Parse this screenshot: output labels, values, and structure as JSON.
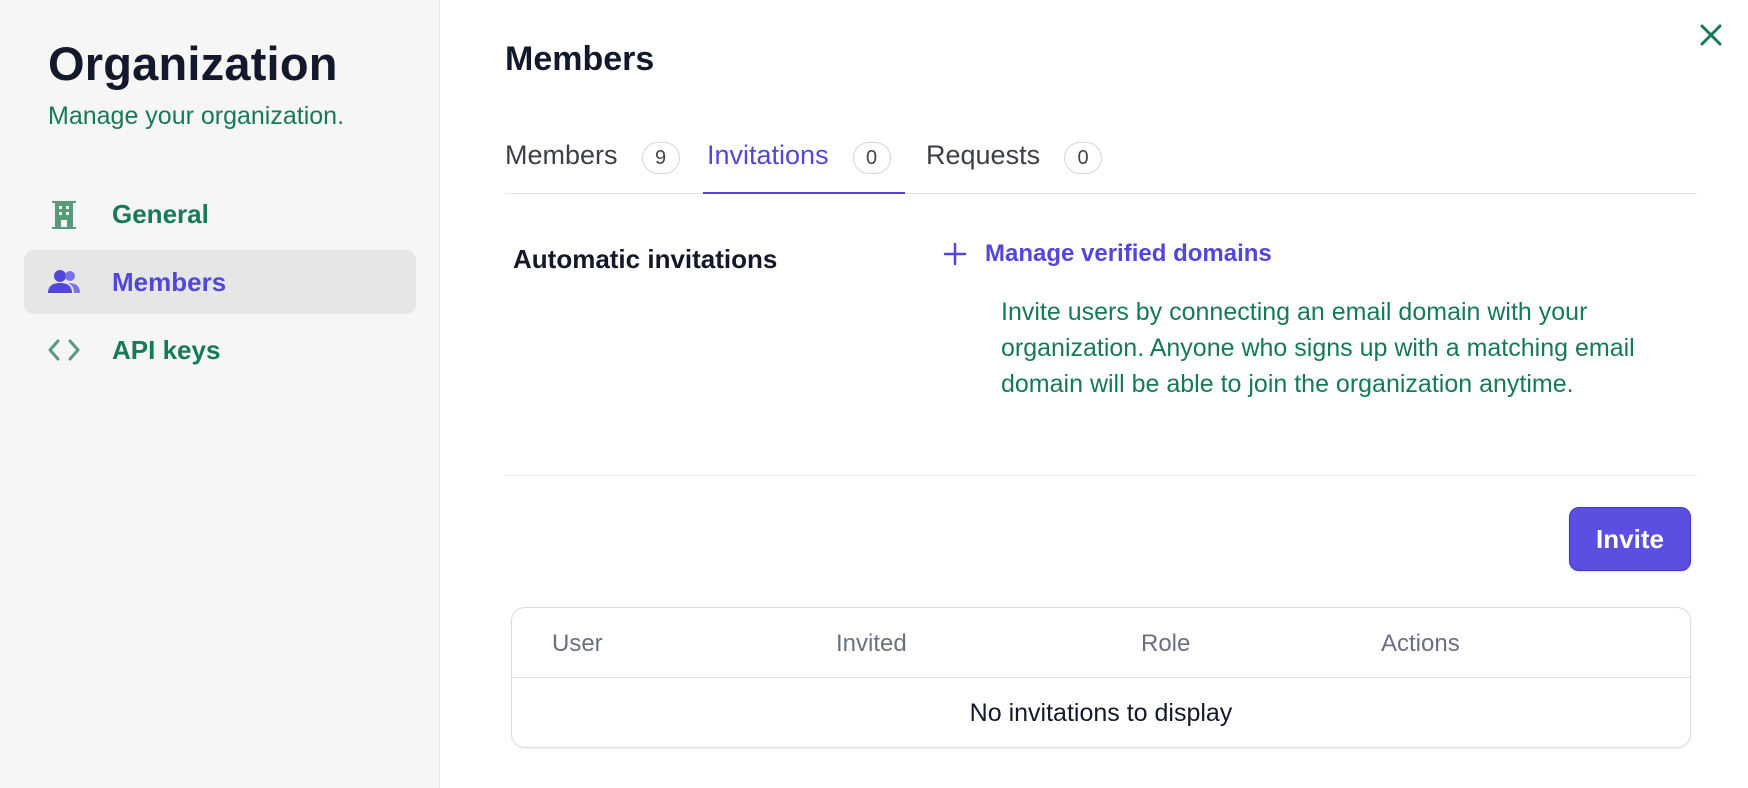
{
  "sidebar": {
    "title": "Organization",
    "subtitle": "Manage your organization.",
    "items": [
      {
        "label": "General",
        "icon": "building-icon",
        "active": false
      },
      {
        "label": "Members",
        "icon": "users-icon",
        "active": true
      },
      {
        "label": "API keys",
        "icon": "code-icon",
        "active": false
      }
    ]
  },
  "main": {
    "title": "Members",
    "close_icon": "close-icon",
    "tabs": [
      {
        "label": "Members",
        "count": "9",
        "active": false
      },
      {
        "label": "Invitations",
        "count": "0",
        "active": true
      },
      {
        "label": "Requests",
        "count": "0",
        "active": false
      }
    ],
    "automatic": {
      "label": "Automatic invitations",
      "link_icon": "plus-icon",
      "link_label": "Manage verified domains",
      "description": "Invite users by connecting an email domain with your organization. Anyone who signs up with a matching email domain will be able to join the organization anytime."
    },
    "invite_label": "Invite",
    "table": {
      "columns": [
        "User",
        "Invited",
        "Role",
        "Actions"
      ],
      "empty_text": "No invitations to display"
    }
  },
  "colors": {
    "accent": "#5247d8",
    "green": "#157a55",
    "text": "#14182b"
  }
}
